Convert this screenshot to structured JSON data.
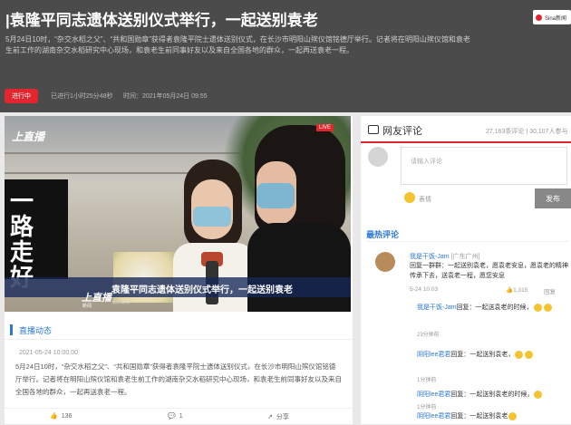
{
  "header": {
    "title": "|袁隆平同志遗体送别仪式举行，一起送别袁老",
    "desc": "5月24日10时，“杂交水稻之父”、“共和国勋章”获得者袁隆平院士遗体送别仪式，在长沙市明阳山殡仪馆铭德厅举行。记者将在明阳山殡仪馆和袁老生前工作的湖南杂交水稻研究中心现场，和袁老生前同事好友以及来自全国各地的群众，一起再送袁老一程。",
    "live_label": "进行中",
    "elapsed": "已进行1小时25分48秒",
    "start_time": "时间：2021年05月24日 09:55",
    "brand": "Sina新闻"
  },
  "video": {
    "logo_top": "上直播",
    "live_badge": "LIVE",
    "banner_text": "一路走好",
    "caption": "袁隆平同志遗体送别仪式举行，一起送别袁老",
    "caption_sub": "长沙现场",
    "logo_bottom": "上直播",
    "bottom_label": "新闻"
  },
  "news": {
    "section_title": "直播动态",
    "time": "2021-05-24 10:00:00",
    "body": "5月24日10时，“杂交水稻之父”、“共和国勋章”获得者袁隆平院士遗体送别仪式，在长沙市明阳山殡仪馆铭德厅举行。记者将在明阳山殡仪馆和袁老生前工作的湖南杂交水稻研究中心现场，和袁老生前同事好友以及来自全国各地的群众，一起再送袁老一程。",
    "likes": "136",
    "comment_count": "1",
    "share_label": "分享"
  },
  "comments": {
    "title": "网友评论",
    "stats": "27,163条评论 | 30,107人参与",
    "placeholder": "请输入评论",
    "emoji_label": "表情",
    "post_label": "发布",
    "hot_title": "最热评论",
    "top": {
      "user": "我是干饭-Jam",
      "location": "[广东广州]",
      "text": "回复一群群：一起送别袁老，愿袁老安息，愿袁老的精神传承下去，送袁老一程，愿您安息",
      "time": "5-24 10:03",
      "likes": "1,315",
      "reply_label": "回复"
    },
    "replies": [
      {
        "user": "我是干饭-Jam",
        "text": "回复：一起送袁老的时候，",
        "tail": "",
        "meta": "23分钟前"
      },
      {
        "user": "阴阳lee君君",
        "text": "回复：一起送别袁老，",
        "tail": "",
        "meta": "1分钟前"
      },
      {
        "user": "阴阳lee君君",
        "text": "回复：一起送别袁老的时候，",
        "tail": "",
        "meta": "1分钟前"
      },
      {
        "user": "阴阳lee君君",
        "text": "回复：一起送别袁老",
        "tail": "",
        "meta": ""
      }
    ]
  }
}
